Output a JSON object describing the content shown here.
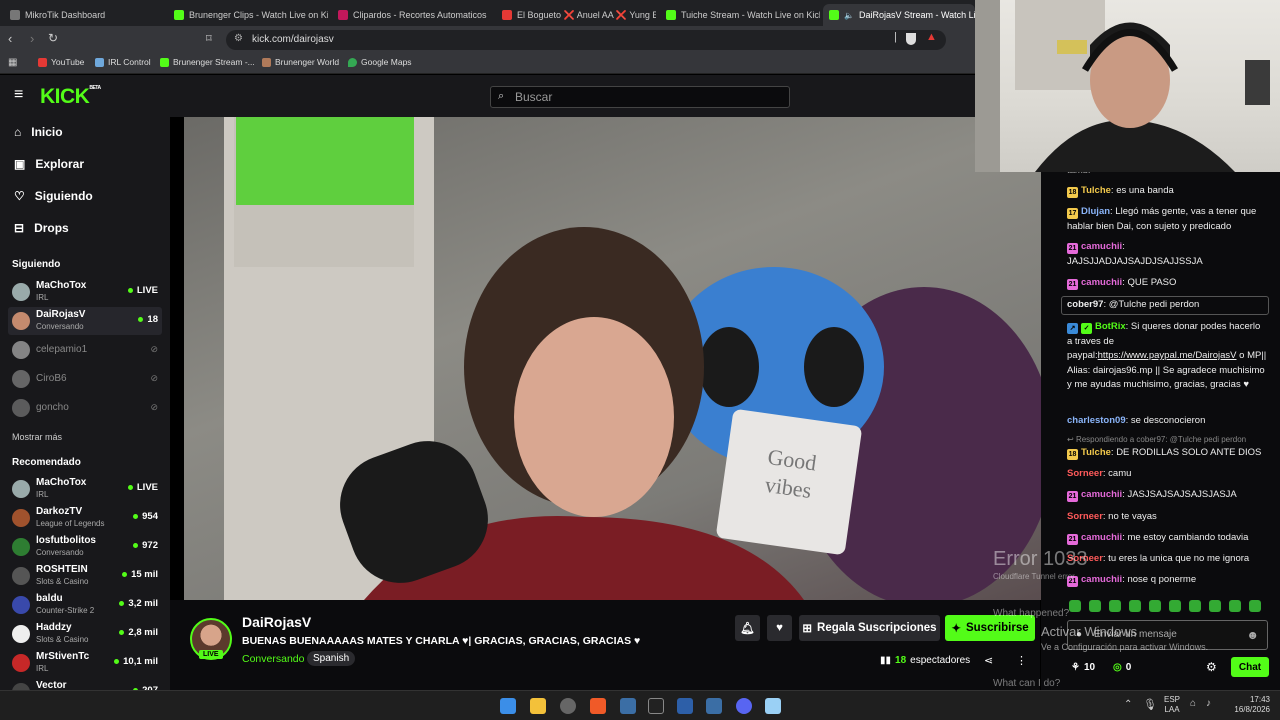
{
  "tabs": [
    {
      "label": "MikroTik Dashboard",
      "color": "#777"
    },
    {
      "label": "Brunenger Clips - Watch Live on Kick",
      "color": "#53fc18"
    },
    {
      "label": "Clipardos - Recortes Automaticos",
      "color": "#c2185b"
    },
    {
      "label": "El Bogueto ❌ Anuel AA ❌ Yung Be",
      "color": "#e53935"
    },
    {
      "label": "Tuiche Stream - Watch Live on Kick",
      "color": "#53fc18"
    },
    {
      "label": "DaiRojasV Stream - Watch Li",
      "color": "#53fc18"
    }
  ],
  "address": {
    "url": "kick.com/dairojasv"
  },
  "bookmarks": [
    {
      "label": "YouTube",
      "color": "#e53935"
    },
    {
      "label": "IRL Control",
      "color": "#6fa8dc"
    },
    {
      "label": "Brunenger Stream -...",
      "color": "#53fc18"
    },
    {
      "label": "Brunenger World",
      "color": "#b07a5a"
    },
    {
      "label": "Google Maps",
      "color": "#34a853"
    }
  ],
  "kick": {
    "logo": "KICK",
    "beta": "BETA",
    "search_placeholder": "Buscar"
  },
  "nav": {
    "home": "Inicio",
    "explore": "Explorar",
    "following": "Siguiendo",
    "drops": "Drops"
  },
  "sidebar": {
    "following_title": "Siguiendo",
    "following": [
      {
        "name": "MaChoTox",
        "category": "IRL",
        "viewers": "LIVE",
        "color": "#9aa"
      },
      {
        "name": "DaiRojasV",
        "category": "Conversando",
        "viewers": "18",
        "color": "#c48a6e"
      },
      {
        "name": "celepamio1",
        "category": "",
        "viewers": "",
        "color": "#ccc"
      },
      {
        "name": "CiroB6",
        "category": "",
        "viewers": "",
        "color": "#999"
      },
      {
        "name": "goncho",
        "category": "",
        "viewers": "",
        "color": "#888"
      }
    ],
    "show_more": "Mostrar más",
    "recommended_title": "Recomendado",
    "recommended": [
      {
        "name": "MaChoTox",
        "category": "IRL",
        "viewers": "LIVE",
        "color": "#9aa"
      },
      {
        "name": "DarkozTV",
        "category": "League of Legends",
        "viewers": "954",
        "color": "#a0522d"
      },
      {
        "name": "losfutbolitos",
        "category": "Conversando",
        "viewers": "972",
        "color": "#2e7d32"
      },
      {
        "name": "ROSHTEIN",
        "category": "Slots & Casino",
        "viewers": "15 mil",
        "color": "#555"
      },
      {
        "name": "baldu",
        "category": "Counter-Strike 2",
        "viewers": "3,2 mil",
        "color": "#3949ab"
      },
      {
        "name": "Haddzy",
        "category": "Slots & Casino",
        "viewers": "2,8 mil",
        "color": "#eee"
      },
      {
        "name": "MrStivenTc",
        "category": "IRL",
        "viewers": "10,1 mil",
        "color": "#c62828"
      },
      {
        "name": "Vector",
        "category": "",
        "viewers": "207",
        "color": "#444"
      }
    ]
  },
  "stream": {
    "channel": "DaiRojasV",
    "live": "LIVE",
    "title": "BUENAS BUENAAAAAS MATES Y CHARLA ♥| GRACIAS, GRACIAS, GRACIAS ♥",
    "category": "Conversando",
    "language": "Spanish",
    "viewers": "18",
    "viewers_label": "espectadores",
    "gift_label": "Regala Suscripciones",
    "subscribe_label": "Suscribirse"
  },
  "chat": {
    "top_fragment": "tambi",
    "messages": [
      {
        "user": "Tulche",
        "color": "#f2c94c",
        "badge": "18",
        "text": ": es una banda"
      },
      {
        "user": "Dlujan",
        "color": "#8ab4f8",
        "badge": "17",
        "text": ": Llegó más gente, vas a tener que hablar bien Dai, con sujeto y predicado"
      },
      {
        "user": "camuchii",
        "color": "#e56ad9",
        "badge": "21",
        "text": ":"
      },
      {
        "user": "",
        "color": "#eee",
        "badge": "",
        "text": "JAJSJJADJAJSAJDJSAJJSSJA"
      },
      {
        "user": "camuchii",
        "color": "#e56ad9",
        "badge": "21",
        "text": ": QUE PASO"
      },
      {
        "user": "cober97",
        "color": "#ffffff",
        "badge": "",
        "text": ": @Tulche pedi perdon"
      },
      {
        "user": "BotRix",
        "color": "#53fc18",
        "badge": "",
        "text": ": Si queres donar podes hacerlo a traves de paypal:"
      },
      {
        "user": "",
        "color": "#eee",
        "badge": "",
        "text": "https://www.paypal.me/DairojasV"
      },
      {
        "user": "",
        "color": "#eee",
        "badge": "",
        "text": " o MP|| Alias: dairojas96.mp || Se agradece muchisimo y me ayudas muchisimo, gracias, gracias ♥"
      },
      {
        "user": "charleston09",
        "color": "#8ab4f8",
        "badge": "",
        "text": ": se desconocieron"
      },
      {
        "user": "",
        "color": "#888",
        "badge": "",
        "text": "Respondiendo a cober97: @Tulche pedi perdon"
      },
      {
        "user": "Tulche",
        "color": "#f2c94c",
        "badge": "18",
        "text": ": DE RODILLAS SOLO ANTE DIOS"
      },
      {
        "user": "Sorneer",
        "color": "#ff5a5a",
        "badge": "",
        "text": ": camu"
      },
      {
        "user": "camuchii",
        "color": "#e56ad9",
        "badge": "21",
        "text": ": JASJSAJSAJSAJSJASJA"
      },
      {
        "user": "Sorneer",
        "color": "#ff5a5a",
        "badge": "",
        "text": ": no te vayas"
      },
      {
        "user": "camuchii",
        "color": "#e56ad9",
        "badge": "21",
        "text": ": me estoy cambiando todavia"
      },
      {
        "user": "Sorneer",
        "color": "#ff5a5a",
        "badge": "",
        "text": ": tu eres la unica que no me ignora"
      },
      {
        "user": "camuchii",
        "color": "#e56ad9",
        "badge": "21",
        "text": ": nose q ponerme"
      }
    ],
    "input_placeholder": "Enviar un mensaje",
    "points": "10",
    "coins": "0",
    "chat_button": "Chat"
  },
  "overlay": {
    "error": "Error 1033",
    "error_sub": "Cloudflare Tunnel error",
    "what_happened": "What happened?",
    "activate": "Activar Windows",
    "activate_sub": "Ve a Configuración para activar Windows.",
    "what_can": "What can I do?"
  },
  "taskbar": {
    "lang": "ESP",
    "lang2": "LAA",
    "time": "17:43",
    "date": "16/8/2026"
  }
}
